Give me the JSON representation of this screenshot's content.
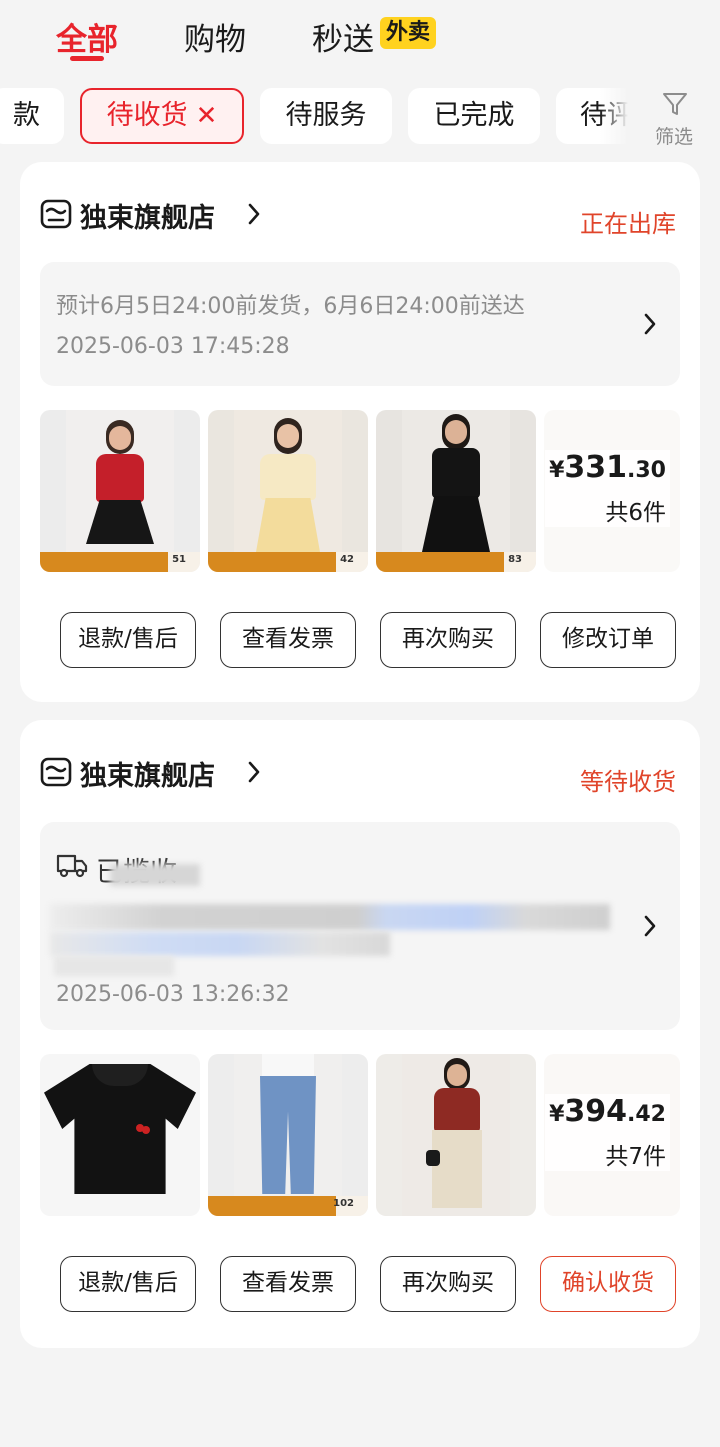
{
  "top_tabs": [
    {
      "label": "全部",
      "active": true
    },
    {
      "label": "购物",
      "active": false
    },
    {
      "label": "秒送",
      "active": false
    }
  ],
  "waimai_badge": "外卖",
  "chips": [
    {
      "label": "款"
    },
    {
      "label": "待收货",
      "active": true
    },
    {
      "label": "待服务"
    },
    {
      "label": "已完成"
    },
    {
      "label": "待评"
    }
  ],
  "filter_label": "筛选",
  "orders": [
    {
      "shop_name": "独束旗舰店",
      "status": "正在出库",
      "info_line1": "预计6月5日24:00前发货，6月6日24:00前送达",
      "info_line2": "2025-06-03 17:45:28",
      "thumb_prices": [
        "51",
        "42",
        "83"
      ],
      "price_symbol": "¥",
      "price_int": "331",
      "price_dec": ".30",
      "count": "共6件",
      "buttons": [
        "退款/售后",
        "查看发票",
        "再次购买",
        "修改订单"
      ]
    },
    {
      "shop_name": "独束旗舰店",
      "status": "等待收货",
      "info_title": "已揽收",
      "info_line2": "2025-06-03 13:26:32",
      "thumb_prices": [
        "102"
      ],
      "price_symbol": "¥",
      "price_int": "394",
      "price_dec": ".42",
      "count": "共7件",
      "buttons": [
        "退款/售后",
        "查看发票",
        "再次购买",
        "确认收货"
      ]
    }
  ],
  "colors": {
    "accent": "#e8242c",
    "status": "#e0442a",
    "badge": "#ffd21f"
  }
}
